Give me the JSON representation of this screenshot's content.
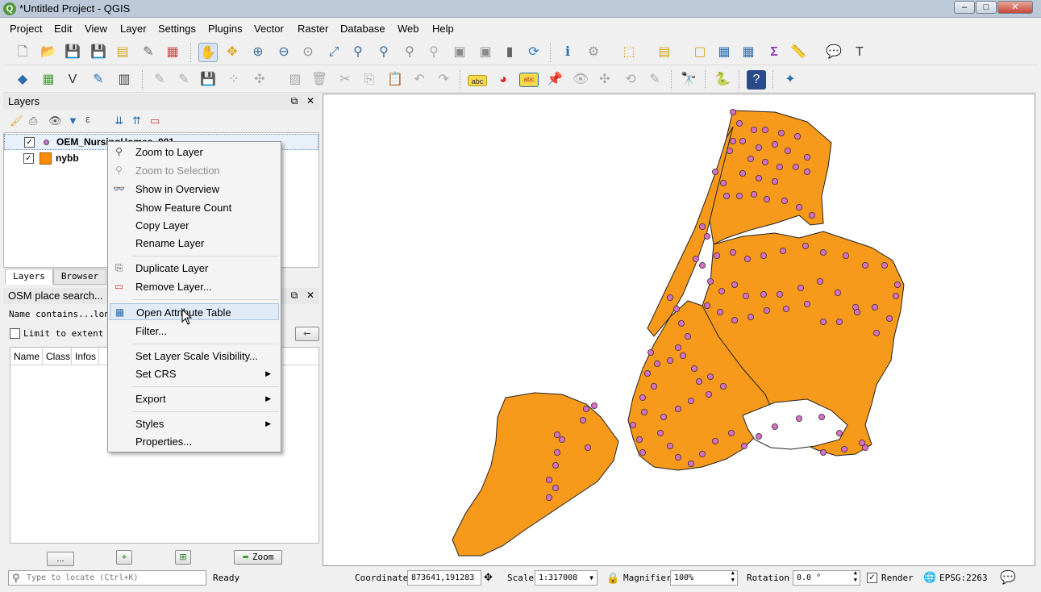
{
  "window": {
    "title": "*Untitled Project - QGIS",
    "app_icon": "qgis-logo-icon",
    "buttons": [
      "minimize",
      "maximize",
      "close"
    ]
  },
  "menubar": {
    "items": [
      "Project",
      "Edit",
      "View",
      "Layer",
      "Settings",
      "Plugins",
      "Vector",
      "Raster",
      "Database",
      "Web",
      "Help"
    ]
  },
  "toolbar1": {
    "icons": [
      "new-project-icon",
      "open-project-icon",
      "save-project-icon",
      "save-as-icon",
      "new-print-composer-icon",
      "composer-manager-icon",
      "style-manager-icon",
      "pan-icon",
      "pan-to-selection-icon",
      "zoom-in-icon",
      "zoom-out-icon",
      "zoom-native-icon",
      "zoom-full-icon",
      "zoom-to-selection-icon",
      "zoom-to-layer-icon",
      "zoom-last-icon",
      "zoom-next-icon",
      "new-bookmark-icon",
      "show-bookmarks-icon",
      "refresh-icon",
      "identify-icon",
      "action-icon",
      "select-features-icon",
      "select-by-value-icon",
      "deselect-icon",
      "attribute-table-icon",
      "field-calculator-icon",
      "statistics-icon",
      "measure-icon",
      "map-tips-icon",
      "text-annotation-icon"
    ]
  },
  "toolbar2": {
    "icons": [
      "add-vector-layer-icon",
      "add-raster-layer-icon",
      "add-delimited-text-icon",
      "add-spatialite-icon",
      "add-wms-icon",
      "digitize-icon",
      "toggle-editing-icon",
      "save-edits-icon",
      "add-feature-icon",
      "move-feature-icon",
      "node-tool-icon",
      "delete-selected-icon",
      "cut-features-icon",
      "copy-features-icon",
      "paste-features-icon",
      "undo-icon",
      "redo-icon",
      "label-toolbar-icon",
      "layer-diagram-icon",
      "highlight-pinned-labels-icon",
      "pin-labels-icon",
      "show-hide-labels-icon",
      "move-label-icon",
      "rotate-label-icon",
      "change-label-icon",
      "osm-place-search-icon",
      "python-console-icon",
      "help-icon",
      "georeferencer-icon"
    ],
    "label_tag": "abc"
  },
  "layers_panel": {
    "title": "Layers",
    "layers": [
      {
        "name": "OEM_NursingHomes_001",
        "checked": true,
        "symbol": "point",
        "color": "#c86dd7"
      },
      {
        "name": "nybb",
        "checked": true,
        "symbol": "polygon",
        "color": "#ff8c00"
      }
    ],
    "tabs": [
      "Layers",
      "Browser"
    ]
  },
  "osm_panel": {
    "title": "OSM place search...",
    "search_label": "Name contains...",
    "search_value": "lon",
    "limit_label": "Limit to extent",
    "limit_checked": false,
    "columns": [
      "Name",
      "Class",
      "Infos"
    ],
    "button_more": "...",
    "button_zoom": "Zoom"
  },
  "context_menu": {
    "items": [
      {
        "label": "Zoom to Layer",
        "icon": "zoom-to-layer-icon"
      },
      {
        "label": "Zoom to Selection",
        "icon": "zoom-to-selection-icon",
        "disabled": true
      },
      {
        "label": "Show in Overview",
        "icon": "overview-glasses-icon"
      },
      {
        "label": "Show Feature Count"
      },
      {
        "label": "Copy Layer"
      },
      {
        "label": "Rename Layer"
      },
      {
        "label": "Duplicate Layer",
        "icon": "duplicate-layer-icon"
      },
      {
        "label": "Remove Layer...",
        "icon": "remove-layer-icon"
      },
      {
        "label": "Open Attribute Table",
        "icon": "attribute-table-icon",
        "highlighted": true
      },
      {
        "label": "Filter..."
      },
      {
        "label": "Set Layer Scale Visibility..."
      },
      {
        "label": "Set CRS",
        "submenu": true
      },
      {
        "label": "Export",
        "submenu": true
      },
      {
        "label": "Styles",
        "submenu": true
      },
      {
        "label": "Properties..."
      }
    ]
  },
  "statusbar": {
    "locate_placeholder": "Type to locate (Ctrl+K)",
    "ready": "Ready",
    "coordinate_label": "Coordinate",
    "coordinate_value": "873641,191283",
    "scale_label": "Scale",
    "scale_value": "1:317008",
    "magnifier_label": "Magnifier",
    "magnifier_value": "100%",
    "rotation_label": "Rotation",
    "rotation_value": "0.0 °",
    "render_label": "Render",
    "render_checked": true,
    "crs": "EPSG:2263"
  },
  "map": {
    "fill_color": "#f7991b",
    "point_color": "#d96fc4",
    "background": "#ffffff"
  }
}
